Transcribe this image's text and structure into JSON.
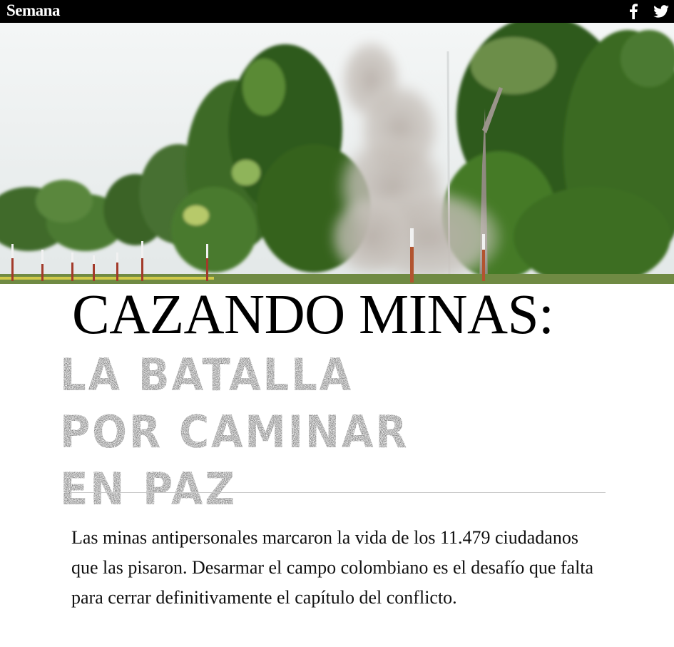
{
  "header": {
    "brand": "Semana",
    "social": [
      {
        "name": "facebook",
        "icon": "facebook-icon"
      },
      {
        "name": "twitter",
        "icon": "twitter-icon"
      }
    ]
  },
  "hero": {
    "scene": "demining-explosion-smoke-forest"
  },
  "article": {
    "title": "CAZANDO MINAS:",
    "subtitle": "LA BATALLA POR CAMINAR EN PAZ",
    "lead": "Las minas antipersonales marcaron la vida de los 11.479 ciudadanos que las pisaron. Desarmar el campo colombiano es el desafío que falta para cerrar definitivamente el capítulo del conflicto."
  },
  "colors": {
    "topbar": "#000000",
    "subtitle": "#7a7a7a",
    "divider": "#c8c8c8"
  }
}
